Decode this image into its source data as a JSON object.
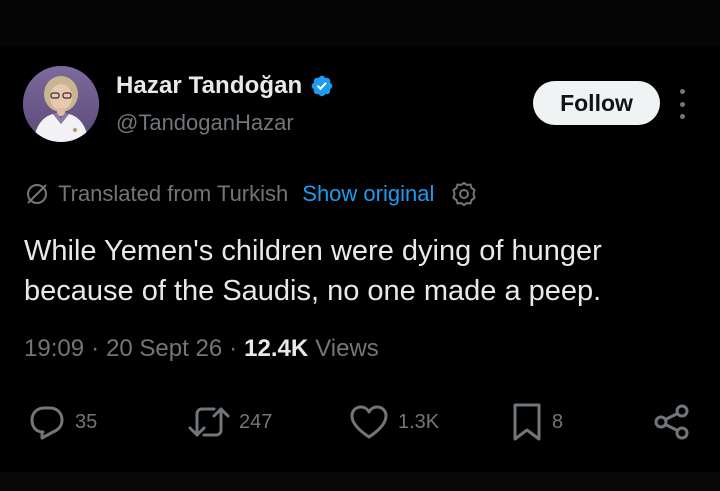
{
  "author": {
    "display_name": "Hazar Tandoğan",
    "handle": "@TandoganHazar",
    "verified": true,
    "avatar_icon": "profile-photo"
  },
  "header": {
    "follow_label": "Follow",
    "more_icon": "more-dots-icon"
  },
  "translation": {
    "label": "Translated from Turkish",
    "show_original": "Show original",
    "settings_icon": "gear-icon"
  },
  "tweet": {
    "text": "While Yemen's children were dying of hunger because of the Saudis, no one made a peep."
  },
  "meta": {
    "time": "19:09",
    "date": "20 Sept 26",
    "views_count": "12.4K",
    "views_label": "Views",
    "separator": "·"
  },
  "actions": {
    "replies": "35",
    "reposts": "247",
    "likes": "1.3K",
    "bookmarks": "8"
  },
  "colors": {
    "background": "#000000",
    "text": "#e7e9ea",
    "muted": "#71767b",
    "link": "#1d9bf0",
    "verified": "#1d9bf0",
    "follow_bg": "#eff3f4"
  }
}
